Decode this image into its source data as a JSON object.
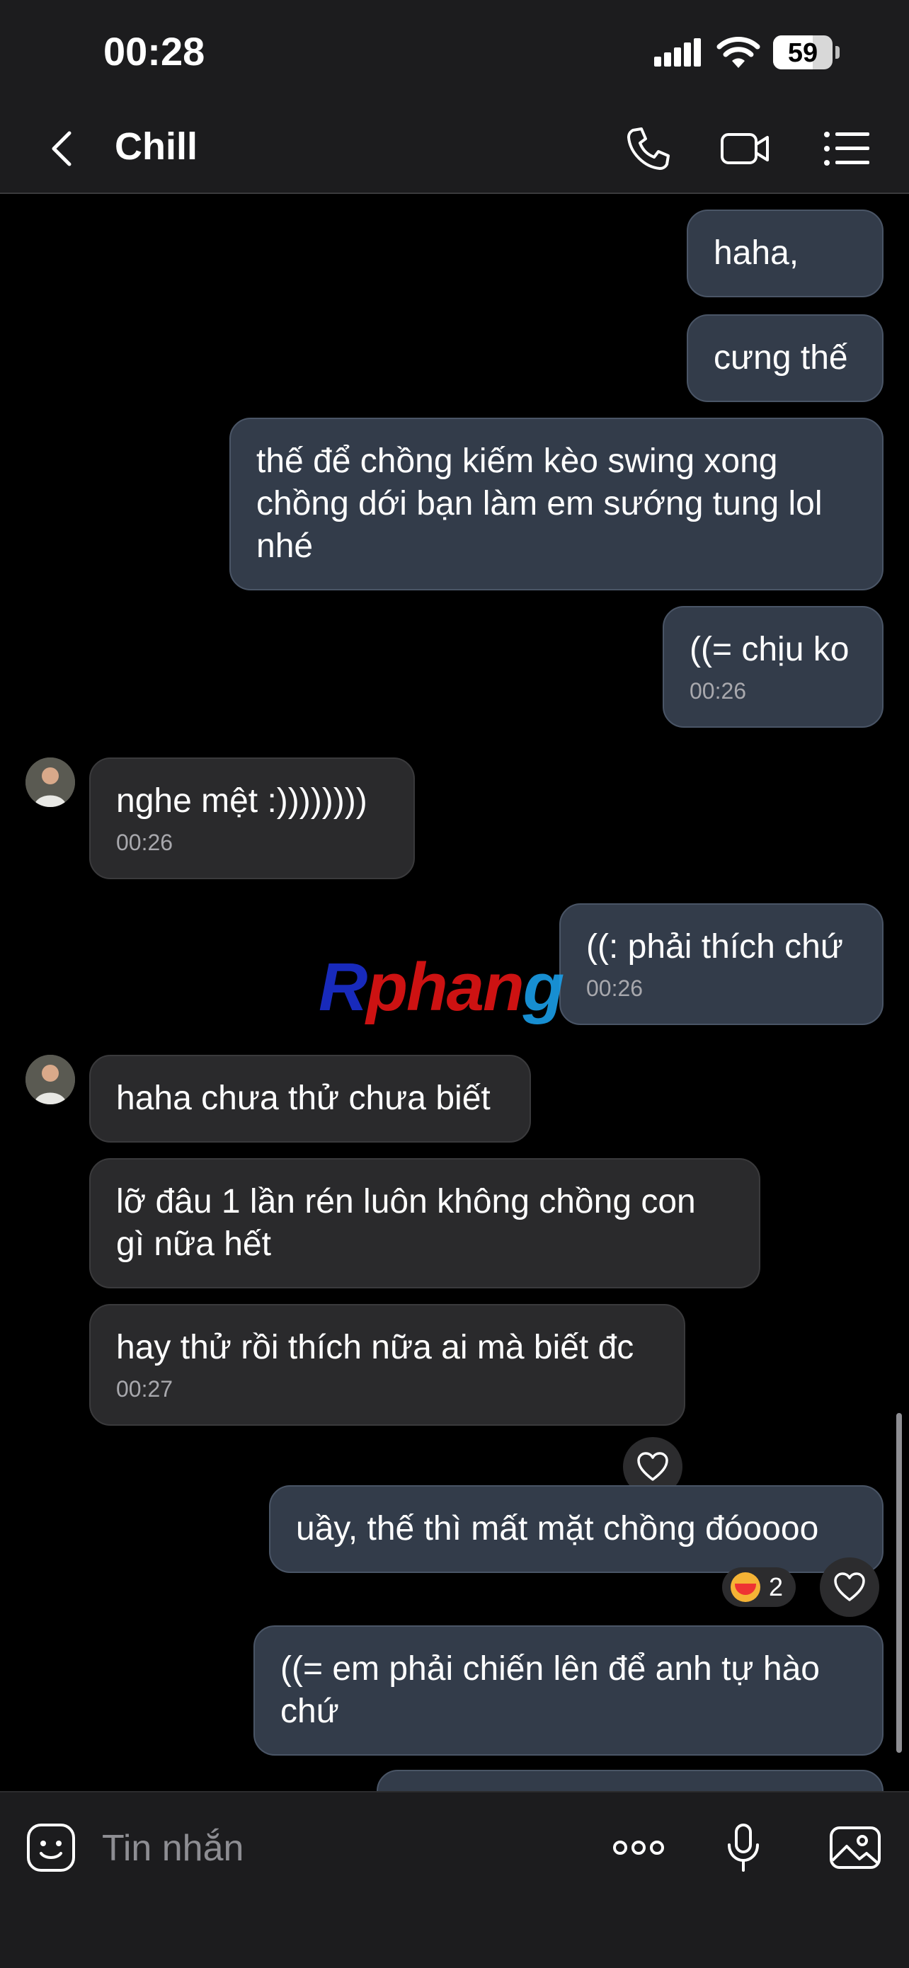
{
  "status": {
    "time": "00:28",
    "battery": "59"
  },
  "header": {
    "title": "Chill"
  },
  "messages": [
    {
      "dir": "out",
      "text": "haha,"
    },
    {
      "dir": "out",
      "text": "cưng thế"
    },
    {
      "dir": "out",
      "text": "thế để chồng kiếm kèo swing xong chồng dới bạn làm em sướng tung lol nhé"
    },
    {
      "dir": "out",
      "text": "((= chịu ko",
      "time": "00:26"
    },
    {
      "dir": "in",
      "text": "nghe mệt :))))))))",
      "time": "00:26"
    },
    {
      "dir": "out",
      "text": "((: phải thích chứ",
      "time": "00:26"
    },
    {
      "dir": "in",
      "text": "haha chưa thử chưa biết"
    },
    {
      "dir": "in",
      "text": "lỡ đâu 1 lần rén luôn không chồng con gì nữa hết"
    },
    {
      "dir": "in",
      "text": "hay thử rồi thích nữa ai mà biết đc",
      "time": "00:27"
    },
    {
      "dir": "out",
      "text": "uầy, thế thì mất mặt chồng đóoooo",
      "reaction_count": "2"
    },
    {
      "dir": "out",
      "text": "((= em phải chiến lên để anh tự hào chứ"
    }
  ],
  "watermark": {
    "r": "R",
    "main": "phan",
    "accent": "g"
  },
  "composer": {
    "placeholder": "Tin nhắn"
  },
  "colors": {
    "outgoing_bubble": "#333c4a",
    "incoming_bubble": "#2a2a2c",
    "background": "#000000",
    "bar": "#1c1c1e"
  },
  "icons": [
    "back-icon",
    "phone-icon",
    "video-icon",
    "menu-icon",
    "heart-icon",
    "sticker-icon",
    "more-icon",
    "mic-icon",
    "image-icon"
  ]
}
